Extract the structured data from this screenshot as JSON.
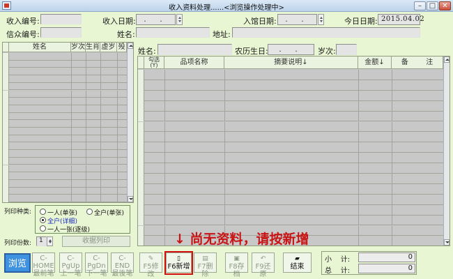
{
  "window": {
    "title": "收入资料处理......<浏览操作处理中>",
    "min": "–",
    "max": "□",
    "close": "✕"
  },
  "header": {
    "income_no_label": "收入编号:",
    "income_date_label": "收入日期:",
    "income_date_value": ". .",
    "admission_date_label": "入馆日期:",
    "admission_date_value": ". .",
    "today_label": "今日日期:",
    "today_value": "2015.04.02",
    "donor_no_label": "信众编号:",
    "name_label": "姓名:",
    "address_label": "地址:"
  },
  "people_table": {
    "columns": [
      "姓名",
      "岁次",
      "生肖",
      "虚岁",
      "殁"
    ],
    "row_count": 20
  },
  "detail_bar": {
    "name_label": "姓名:",
    "lunar_birthday_label": "农历生日:",
    "lunar_birthday_value": ". .",
    "age_label": "岁次:"
  },
  "items_table": {
    "columns": [
      {
        "label": "勾选\n(Y)"
      },
      {
        "label": "品项名称"
      },
      {
        "label": "摘要说明↓"
      },
      {
        "label": "金额↓"
      },
      {
        "label": "备        注"
      }
    ],
    "row_count": 17
  },
  "print_panel": {
    "type_label": "列印种类:",
    "options": [
      {
        "label": "一人(单张)",
        "selected": false
      },
      {
        "label": "全户(单张)",
        "selected": false
      },
      {
        "label": "全户(详细)",
        "selected": true
      },
      {
        "label": "一人一张(逐级)",
        "selected": false
      }
    ],
    "copies_label": "列印份数:",
    "copies_value": "1",
    "print_button": "收据列印"
  },
  "toolbar": [
    {
      "name": "browse-button",
      "line1": "浏览",
      "line2": "",
      "icon": "",
      "state": "browse"
    },
    {
      "name": "first-record-button",
      "line1": "C-HOME",
      "line2": "最前笔",
      "icon": "",
      "state": "disabled"
    },
    {
      "name": "prev-record-button",
      "line1": "C-PgUp",
      "line2": "上一笔",
      "icon": "",
      "state": "disabled"
    },
    {
      "name": "next-record-button",
      "line1": "C-PgDn",
      "line2": "下一笔",
      "icon": "",
      "state": "disabled"
    },
    {
      "name": "last-record-button",
      "line1": "C-END",
      "line2": "最後笔",
      "icon": "",
      "state": "disabled"
    },
    {
      "name": "edit-button",
      "line1": "",
      "line2": "F5修改",
      "icon": "✎",
      "state": "disabled"
    },
    {
      "name": "add-button",
      "line1": "",
      "line2": "F6新增",
      "icon": "▯",
      "state": "active"
    },
    {
      "name": "delete-button",
      "line1": "",
      "line2": "F7删除",
      "icon": "▤",
      "state": "disabled"
    },
    {
      "name": "save-button",
      "line1": "",
      "line2": "F8存档",
      "icon": "▣",
      "state": "disabled"
    },
    {
      "name": "restore-button",
      "line1": "",
      "line2": "F9还原",
      "icon": "↶",
      "state": "disabled"
    },
    {
      "name": "exit-button",
      "line1": "",
      "line2": "结束",
      "icon": "▰",
      "state": "active"
    }
  ],
  "notice": "↓ 尚无资料，请按新增",
  "totals": {
    "subtotal_label": "小    计:",
    "subtotal_value": "0",
    "total_label": "总    计:",
    "total_value": "0"
  },
  "colors": {
    "background": "#e9f6d4",
    "grid": "#c8c8c8",
    "notice": "#c81414",
    "highlight_box": "#d10d0d",
    "browse": "#3f92e0"
  }
}
